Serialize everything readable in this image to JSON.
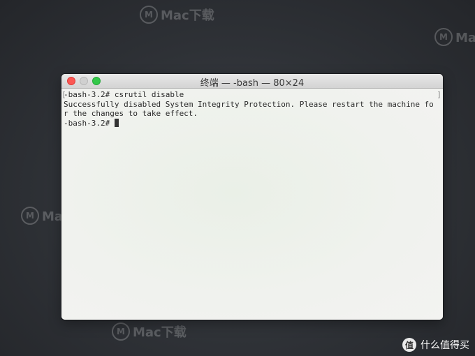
{
  "window": {
    "title": "终端 — -bash — 80×24"
  },
  "terminal": {
    "lines": [
      "-bash-3.2# csrutil disable",
      "Successfully disabled System Integrity Protection. Please restart the machine fo",
      "r the changes to take effect.",
      "-bash-3.2# "
    ]
  },
  "watermark": {
    "text": "Mac下载"
  },
  "brand": {
    "badge": "值",
    "text": "什么值得买"
  },
  "colors": {
    "close": "#fc5753",
    "minimize": "#d0d0d0",
    "maximize": "#34c84a"
  }
}
